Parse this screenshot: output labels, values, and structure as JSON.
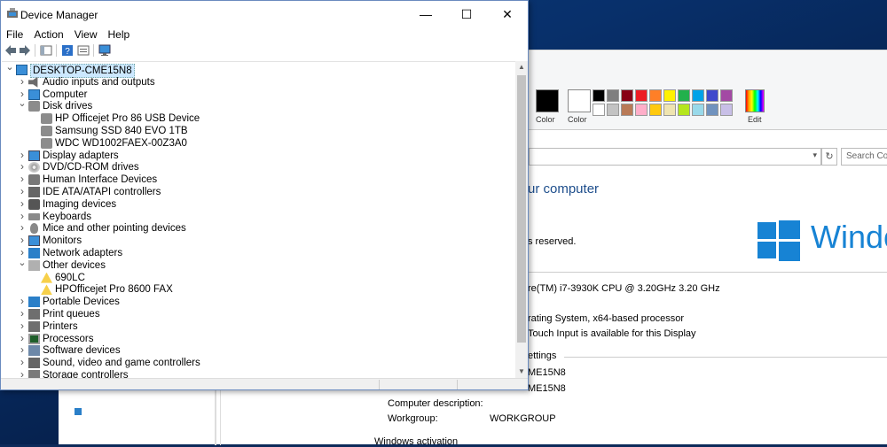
{
  "device_manager": {
    "title": "Device Manager",
    "window_controls": {
      "minimize": "—",
      "maximize": "☐",
      "close": "✕"
    },
    "menu": [
      "File",
      "Action",
      "View",
      "Help"
    ],
    "tree": [
      {
        "label": "DESKTOP-CME15N8",
        "level": 0,
        "expanded": true,
        "icon": "computer-icon",
        "selected": true
      },
      {
        "label": "Audio inputs and outputs",
        "level": 1,
        "expanded": false,
        "icon": "speaker-icon"
      },
      {
        "label": "Computer",
        "level": 1,
        "expanded": false,
        "icon": "computer-icon"
      },
      {
        "label": "Disk drives",
        "level": 1,
        "expanded": true,
        "icon": "disk-drive-icon"
      },
      {
        "label": "HP Officejet Pro 86 USB Device",
        "level": 2,
        "icon": "disk-drive-icon"
      },
      {
        "label": "Samsung SSD 840 EVO 1TB",
        "level": 2,
        "icon": "disk-drive-icon"
      },
      {
        "label": "WDC WD1002FAEX-00Z3A0",
        "level": 2,
        "icon": "disk-drive-icon"
      },
      {
        "label": "Display adapters",
        "level": 1,
        "expanded": false,
        "icon": "display-adapter-icon"
      },
      {
        "label": "DVD/CD-ROM drives",
        "level": 1,
        "expanded": false,
        "icon": "dvd-icon"
      },
      {
        "label": "Human Interface Devices",
        "level": 1,
        "expanded": false,
        "icon": "hid-icon"
      },
      {
        "label": "IDE ATA/ATAPI controllers",
        "level": 1,
        "expanded": false,
        "icon": "ide-controller-icon"
      },
      {
        "label": "Imaging devices",
        "level": 1,
        "expanded": false,
        "icon": "camera-icon"
      },
      {
        "label": "Keyboards",
        "level": 1,
        "expanded": false,
        "icon": "keyboard-icon"
      },
      {
        "label": "Mice and other pointing devices",
        "level": 1,
        "expanded": false,
        "icon": "mouse-icon"
      },
      {
        "label": "Monitors",
        "level": 1,
        "expanded": false,
        "icon": "monitor-icon"
      },
      {
        "label": "Network adapters",
        "level": 1,
        "expanded": false,
        "icon": "network-icon"
      },
      {
        "label": "Other devices",
        "level": 1,
        "expanded": true,
        "icon": "unknown-device-icon"
      },
      {
        "label": "690LC",
        "level": 2,
        "icon": "warning-device-icon"
      },
      {
        "label": "HPOfficejet Pro 8600 FAX",
        "level": 2,
        "icon": "warning-device-icon"
      },
      {
        "label": "Portable Devices",
        "level": 1,
        "expanded": false,
        "icon": "portable-device-icon"
      },
      {
        "label": "Print queues",
        "level": 1,
        "expanded": false,
        "icon": "printer-icon"
      },
      {
        "label": "Printers",
        "level": 1,
        "expanded": false,
        "icon": "printer-icon"
      },
      {
        "label": "Processors",
        "level": 1,
        "expanded": false,
        "icon": "processor-icon"
      },
      {
        "label": "Software devices",
        "level": 1,
        "expanded": false,
        "icon": "software-device-icon"
      },
      {
        "label": "Sound, video and game controllers",
        "level": 1,
        "expanded": false,
        "icon": "sound-icon"
      },
      {
        "label": "Storage controllers",
        "level": 1,
        "expanded": false,
        "icon": "storage-icon"
      }
    ]
  },
  "paint": {
    "color1_label": "Color",
    "color2_label": "Color",
    "edit_label": "Edit",
    "palette_row1": [
      "#000000",
      "#7f7f7f",
      "#880015",
      "#ed1c24",
      "#ff7f27",
      "#fff200",
      "#22b14c",
      "#00a2e8",
      "#3f48cc",
      "#a349a4"
    ],
    "palette_row2": [
      "#ffffff",
      "#c3c3c3",
      "#b97a57",
      "#ffaec9",
      "#ffc90e",
      "#efe4b0",
      "#b5e61d",
      "#99d9ea",
      "#7092be",
      "#c8bfe7"
    ]
  },
  "system": {
    "search_placeholder": "Search Con",
    "heading": "ur computer",
    "rights": "s reserved.",
    "windows_word": "Windo",
    "cpu": "re(TM) i7-3930K CPU @ 3.20GHz   3.20 GHz",
    "os_type": "rating System, x64-based processor",
    "touch": "Touch Input is available for this Display",
    "settings_heading": "ettings",
    "computer_name": "ME15N8",
    "full_name": "ME15N8",
    "desc_label": "Computer description:",
    "workgroup_label": "Workgroup:",
    "workgroup_value": "WORKGROUP",
    "activation": "Windows activation"
  }
}
